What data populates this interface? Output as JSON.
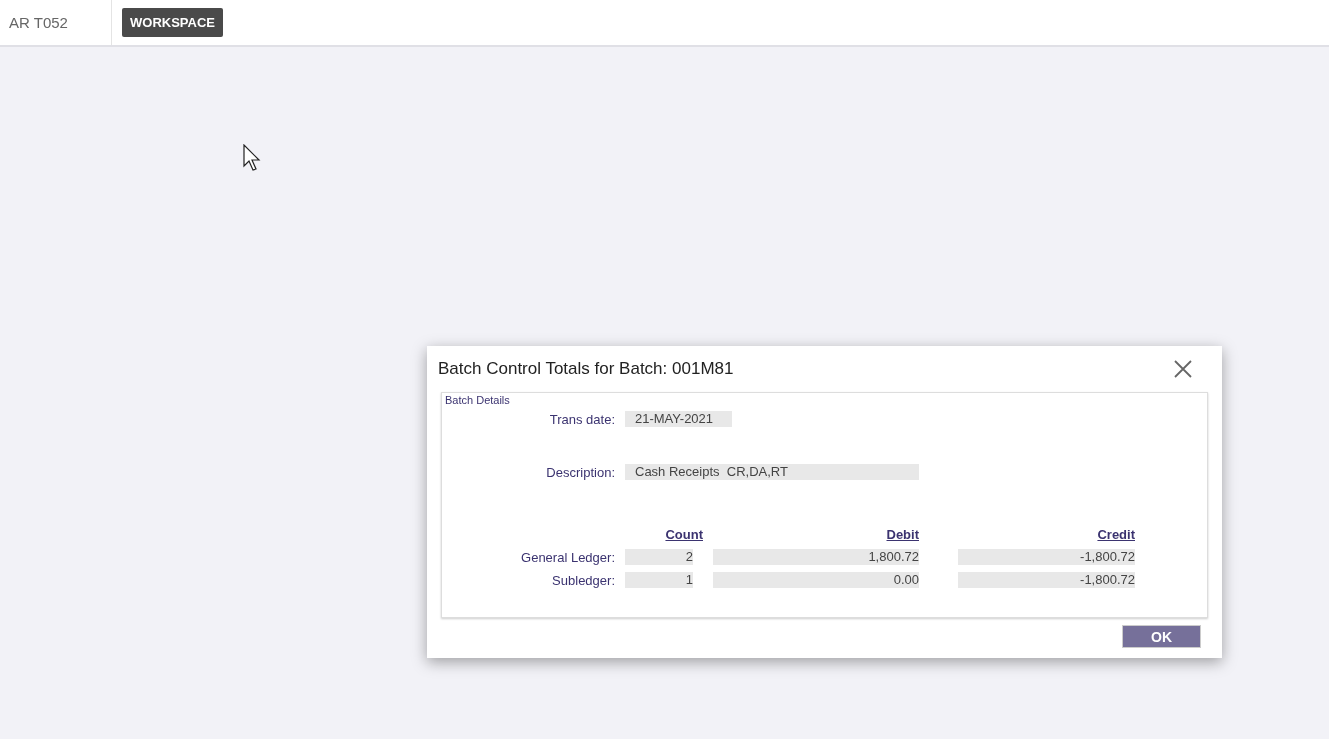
{
  "app": {
    "title": "AR T052",
    "workspace_button": "WORKSPACE"
  },
  "dialog": {
    "title": "Batch Control Totals for Batch: 001M81",
    "legend": "Batch Details",
    "fields": [
      {
        "label": "Trans date:",
        "value": "21-MAY-2021"
      },
      {
        "label": "Description:",
        "value": "Cash Receipts  CR,DA,RT"
      }
    ],
    "columns": [
      "Count",
      "Debit",
      "Credit"
    ],
    "rows": [
      {
        "label": "General Ledger:",
        "values": [
          "2",
          "1,800.72",
          "-1,800.72"
        ]
      },
      {
        "label": "Subledger:",
        "values": [
          "1",
          "0.00",
          "-1,800.72"
        ]
      }
    ],
    "ok_button": "OK"
  }
}
